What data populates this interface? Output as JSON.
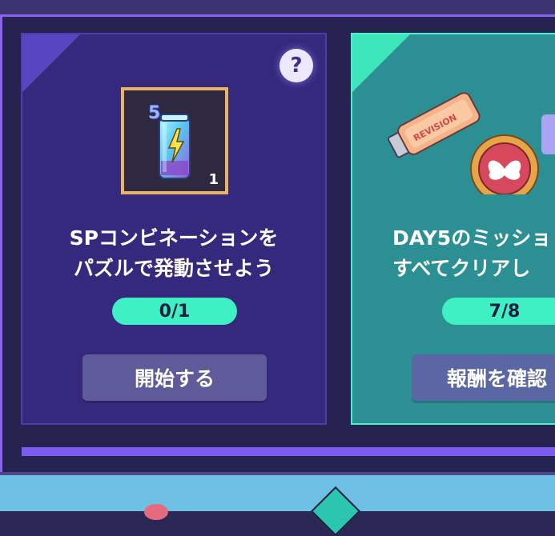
{
  "missions": [
    {
      "item_level": "5",
      "item_count": "1",
      "title_line1": "SPコンビネーションを",
      "title_line2": "パズルで発動させよう",
      "progress": "0/1",
      "button_label": "開始する",
      "help_label": "?"
    },
    {
      "usb_label": "REVISION",
      "title_line1": "DAY5のミッショ",
      "title_line2": "すべてクリアし",
      "progress": "7/8",
      "button_label": "報酬を確認"
    }
  ],
  "colors": {
    "accent": "#8a62f0",
    "progress": "#3ff0c5",
    "card_a": "#35297e",
    "card_b": "#2c8f93"
  }
}
